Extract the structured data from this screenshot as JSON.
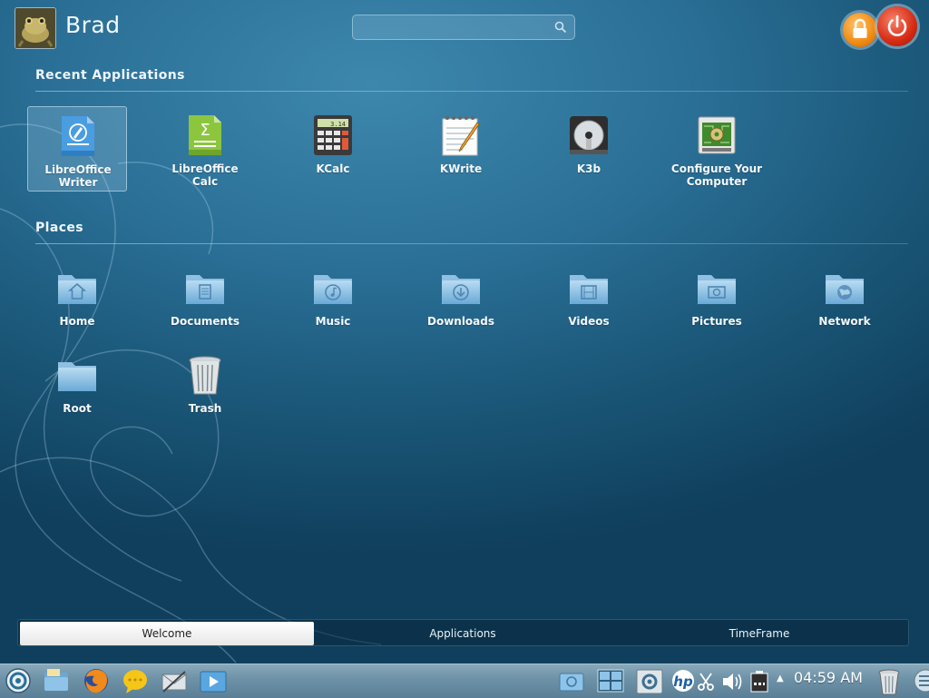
{
  "user": {
    "name": "Brad"
  },
  "search": {
    "value": "",
    "placeholder": ""
  },
  "recent": {
    "title": "Recent Applications",
    "items": [
      {
        "label": "LibreOffice\nWriter",
        "icon": "libreoffice-writer-icon"
      },
      {
        "label": "LibreOffice\nCalc",
        "icon": "libreoffice-calc-icon"
      },
      {
        "label": "KCalc",
        "icon": "calculator-icon"
      },
      {
        "label": "KWrite",
        "icon": "text-editor-icon"
      },
      {
        "label": "K3b",
        "icon": "disc-burner-icon"
      },
      {
        "label": "Configure Your\nComputer",
        "icon": "system-settings-icon"
      }
    ]
  },
  "places": {
    "title": "Places",
    "items": [
      {
        "label": "Home",
        "icon": "home-folder-icon"
      },
      {
        "label": "Documents",
        "icon": "documents-folder-icon"
      },
      {
        "label": "Music",
        "icon": "music-folder-icon"
      },
      {
        "label": "Downloads",
        "icon": "downloads-folder-icon"
      },
      {
        "label": "Videos",
        "icon": "videos-folder-icon"
      },
      {
        "label": "Pictures",
        "icon": "pictures-folder-icon"
      },
      {
        "label": "Network",
        "icon": "network-folder-icon"
      },
      {
        "label": "Root",
        "icon": "root-folder-icon"
      },
      {
        "label": "Trash",
        "icon": "trash-icon"
      }
    ]
  },
  "tabs": [
    {
      "label": "Welcome",
      "active": true
    },
    {
      "label": "Applications",
      "active": false
    },
    {
      "label": "TimeFrame",
      "active": false
    }
  ],
  "taskbar": {
    "clock": "04:59 AM"
  },
  "colors": {
    "lock": "#f08a13",
    "power": "#d62b12",
    "calc_green": "#8cc63f",
    "writer_blue": "#3d8fd6"
  }
}
